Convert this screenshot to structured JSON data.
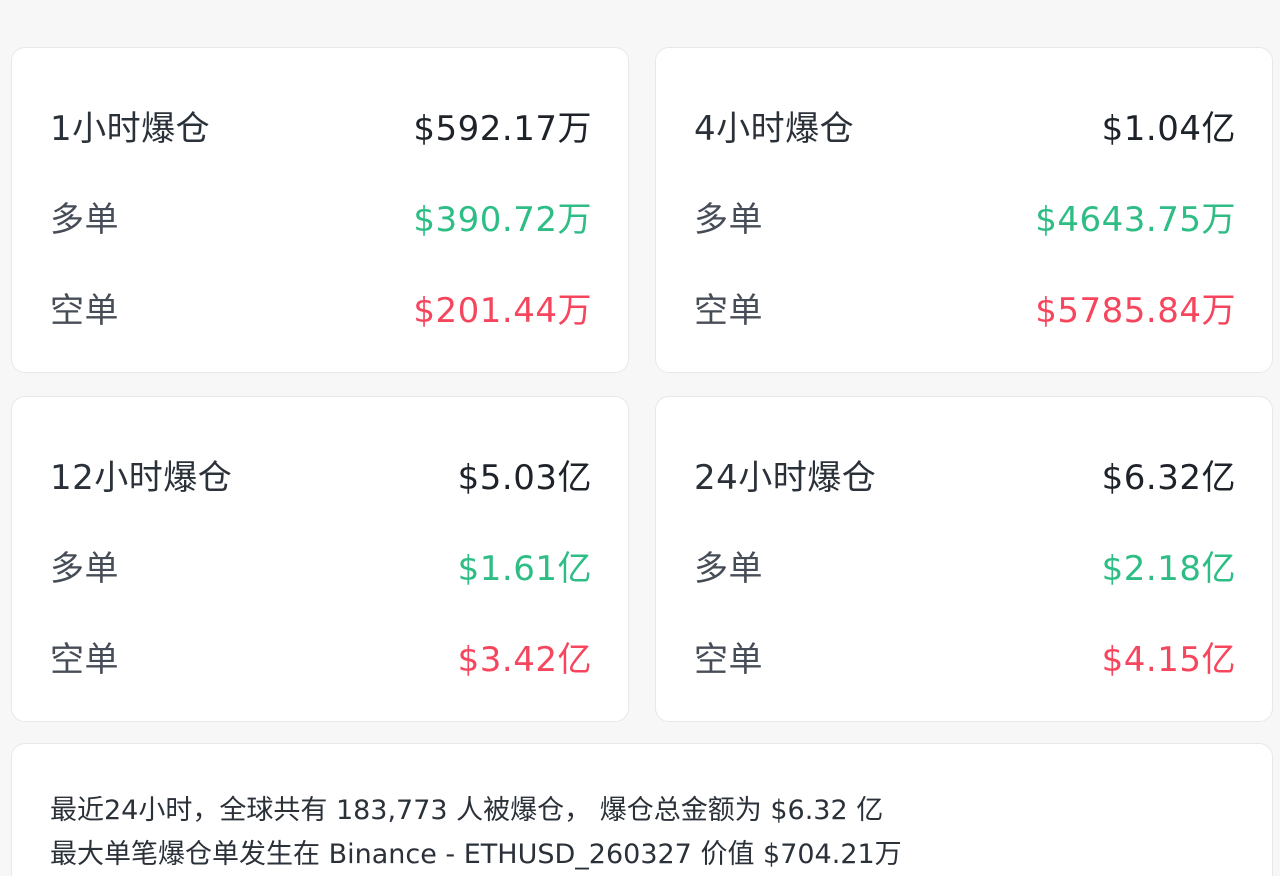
{
  "cards": [
    {
      "title": "1小时爆仓",
      "total": "$592.17万",
      "long_label": "多单",
      "long_value": "$390.72万",
      "short_label": "空单",
      "short_value": "$201.44万"
    },
    {
      "title": "4小时爆仓",
      "total": "$1.04亿",
      "long_label": "多单",
      "long_value": "$4643.75万",
      "short_label": "空单",
      "short_value": "$5785.84万"
    },
    {
      "title": "12小时爆仓",
      "total": "$5.03亿",
      "long_label": "多单",
      "long_value": "$1.61亿",
      "short_label": "空单",
      "short_value": "$3.42亿"
    },
    {
      "title": "24小时爆仓",
      "total": "$6.32亿",
      "long_label": "多单",
      "long_value": "$2.18亿",
      "short_label": "空单",
      "short_value": "$4.15亿"
    }
  ],
  "summary": {
    "line1": "最近24小时，全球共有 183,773 人被爆仓， 爆仓总金额为 $6.32 亿",
    "line2": "最大单笔爆仓单发生在 Binance - ETHUSD_260327 价值 $704.21万"
  },
  "colors": {
    "long": "#2ebd85",
    "short": "#f6465d",
    "text": "#1e2329",
    "background": "#f7f7f8",
    "card": "#ffffff"
  }
}
